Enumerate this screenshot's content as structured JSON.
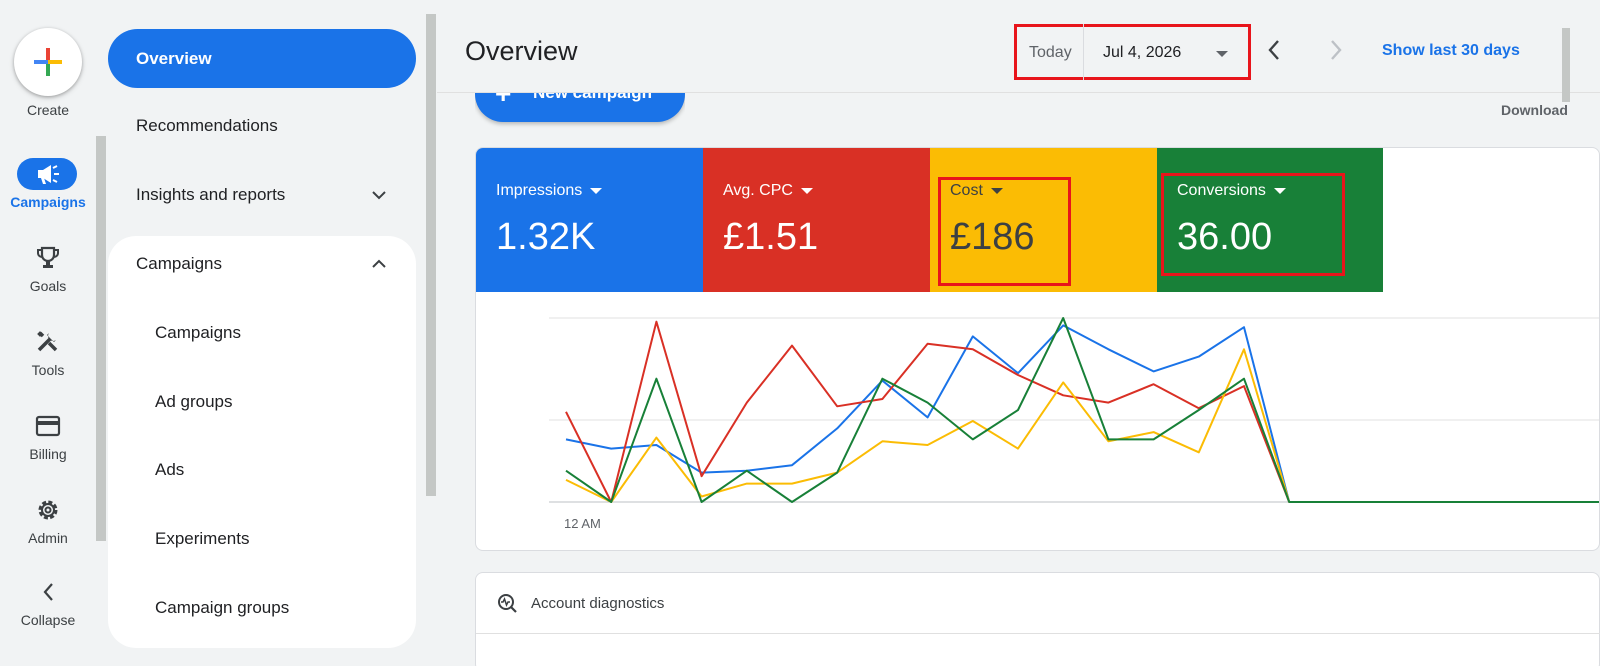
{
  "rail": {
    "create_label": "Create",
    "items": [
      {
        "label": "Campaigns",
        "icon": "campaigns-megaphone-icon",
        "active": true
      },
      {
        "label": "Goals",
        "icon": "trophy-icon",
        "active": false
      },
      {
        "label": "Tools",
        "icon": "tools-icon",
        "active": false
      },
      {
        "label": "Billing",
        "icon": "credit-card-icon",
        "active": false
      },
      {
        "label": "Admin",
        "icon": "gear-icon",
        "active": false
      }
    ],
    "collapse_label": "Collapse"
  },
  "nav": {
    "overview": "Overview",
    "recommendations": "Recommendations",
    "insights": "Insights and reports",
    "campaigns_group": "Campaigns",
    "sub_items": [
      "Campaigns",
      "Ad groups",
      "Ads",
      "Experiments",
      "Campaign groups"
    ]
  },
  "header": {
    "title": "Overview",
    "date_prefix": "Today",
    "date_value": "Jul 4, 2026",
    "show_last": "Show last 30 days",
    "new_campaign": "New campaign",
    "download": "Download"
  },
  "metrics": [
    {
      "label": "Impressions",
      "value": "1.32K",
      "color": "#1a73e8"
    },
    {
      "label": "Avg. CPC",
      "value": "£1.51",
      "color": "#d93025"
    },
    {
      "label": "Cost",
      "value": "£186",
      "color": "#fbbc04"
    },
    {
      "label": "Conversions",
      "value": "36.00",
      "color": "#188038"
    }
  ],
  "chart_data": {
    "type": "line",
    "x_tick_first": "12 AM",
    "grid": true,
    "series": [
      {
        "color": "#1a73e8",
        "values": [
          0.34,
          0.29,
          0.31,
          0.16,
          0.17,
          0.2,
          0.4,
          0.66,
          0.46,
          0.9,
          0.7,
          0.96,
          0.83,
          0.71,
          0.79,
          0.95,
          0,
          0,
          0,
          0,
          0,
          0,
          0,
          0,
          0,
          0
        ]
      },
      {
        "color": "#d93025",
        "values": [
          0.49,
          0,
          0.98,
          0.14,
          0.54,
          0.85,
          0.52,
          0.56,
          0.86,
          0.83,
          0.69,
          0.58,
          0.54,
          0.64,
          0.51,
          0.63,
          0,
          0,
          0,
          0,
          0,
          0,
          0,
          0,
          0,
          0
        ]
      },
      {
        "color": "#fbbc04",
        "values": [
          0.12,
          0,
          0.35,
          0.03,
          0.1,
          0.1,
          0.16,
          0.33,
          0.31,
          0.44,
          0.29,
          0.65,
          0.33,
          0.38,
          0.27,
          0.83,
          0,
          0,
          0,
          0,
          0,
          0,
          0,
          0,
          0,
          0
        ]
      },
      {
        "color": "#188038",
        "values": [
          0.17,
          0,
          0.67,
          0,
          0.17,
          0,
          0.16,
          0.67,
          0.54,
          0.34,
          0.5,
          1.0,
          0.34,
          0.34,
          0.5,
          0.67,
          0,
          0,
          0,
          0,
          0,
          0,
          0,
          0,
          0,
          0
        ]
      }
    ]
  },
  "diagnostics": {
    "title": "Account diagnostics"
  }
}
